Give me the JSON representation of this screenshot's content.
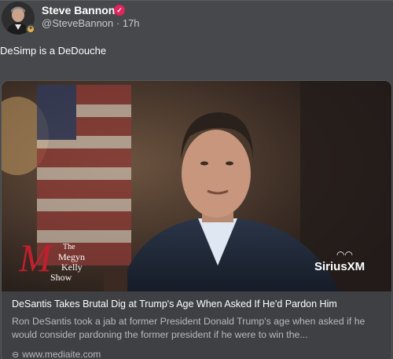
{
  "post": {
    "author_name": "Steve Bannon",
    "handle": "@SteveBannon",
    "time": "17h",
    "text": "DeSimp is a DeDouche"
  },
  "card": {
    "title": "DeSantis Takes Brutal Dig at Trump's Age When Asked If He'd Pardon Him",
    "description": "Ron DeSantis took a jab at former President Donald Trump's age when asked if he would consider pardoning the former president if he were to win the...",
    "domain": "www.mediaite.com",
    "show_logo": {
      "line1": "The",
      "line2": "Megyn",
      "line3": "Kelly",
      "line4": "Show",
      "monogram": "M"
    },
    "network_logo": "SiriusXM"
  },
  "colors": {
    "background": "#46484b",
    "verified": "#e0245e",
    "show_logo_red": "#c21f2e"
  }
}
